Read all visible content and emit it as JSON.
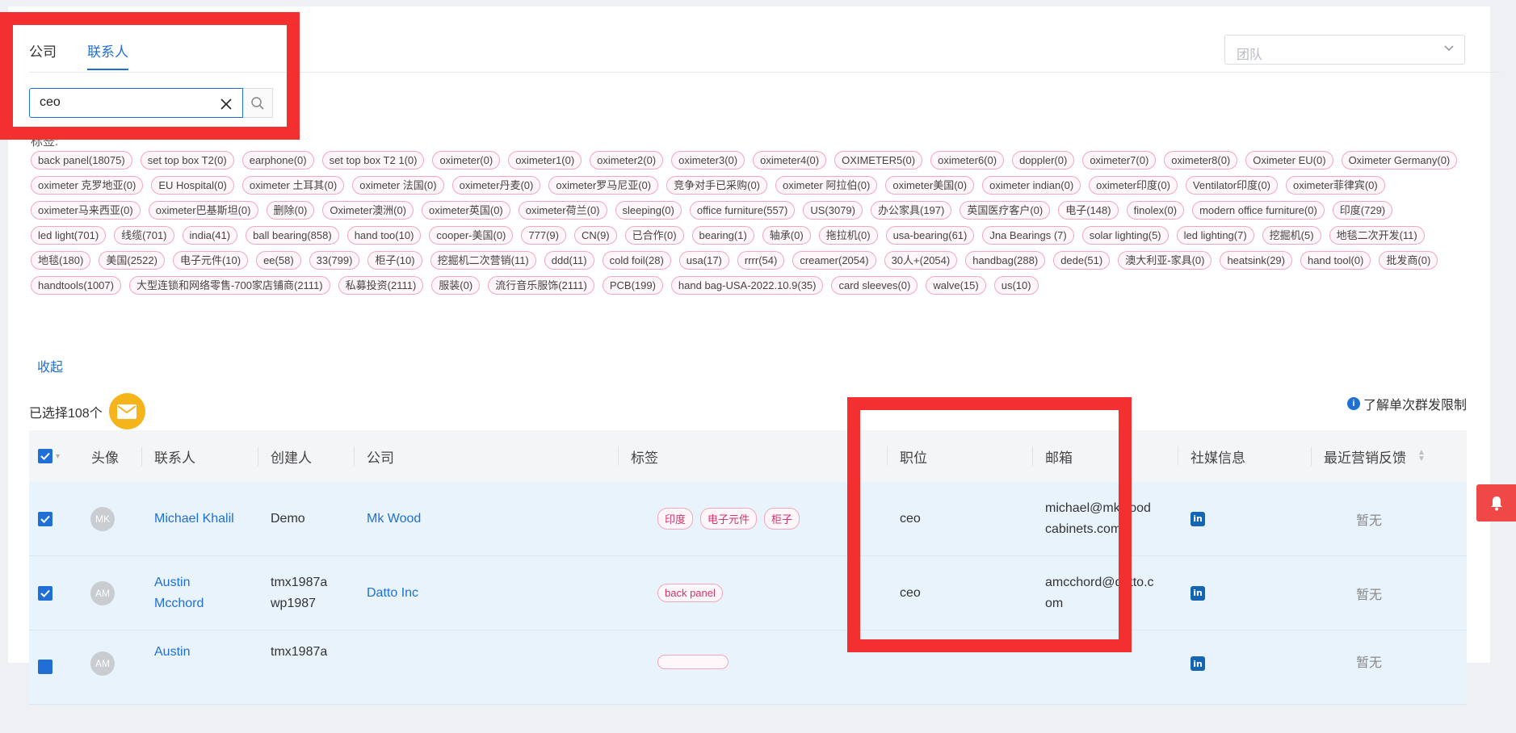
{
  "tabs": [
    {
      "label": "公司"
    },
    {
      "label": "联系人"
    }
  ],
  "team_select": {
    "placeholder": "团队"
  },
  "search": {
    "value": "ceo"
  },
  "tags_label": "标签:",
  "tags": [
    "back panel(18075)",
    "set top box T2(0)",
    "earphone(0)",
    "set top box T2 1(0)",
    "oximeter(0)",
    "oximeter1(0)",
    "oximeter2(0)",
    "oximeter3(0)",
    "oximeter4(0)",
    "OXIMETER5(0)",
    "oximeter6(0)",
    "doppler(0)",
    "oximeter7(0)",
    "oximeter8(0)",
    "Oximeter EU(0)",
    "Oximeter Germany(0)",
    "oximeter 克罗地亚(0)",
    "EU Hospital(0)",
    "oximeter 土耳其(0)",
    "oximeter 法国(0)",
    "oximeter丹麦(0)",
    "oximeter罗马尼亚(0)",
    "竞争对手已采购(0)",
    "oximeter 阿拉伯(0)",
    "oximeter美国(0)",
    "oximeter indian(0)",
    "oximeter印度(0)",
    "Ventilator印度(0)",
    "oximeter菲律宾(0)",
    "oximeter马来西亚(0)",
    "oximeter巴基斯坦(0)",
    "删除(0)",
    "Oximeter澳洲(0)",
    "oximeter英国(0)",
    "oximeter荷兰(0)",
    "sleeping(0)",
    "office furniture(557)",
    "US(3079)",
    "办公家具(197)",
    "英国医疗客户(0)",
    "电子(148)",
    "finolex(0)",
    "modern office furniture(0)",
    "印度(729)",
    "led light(701)",
    "线缆(701)",
    "india(41)",
    "ball bearing(858)",
    "hand too(10)",
    "cooper-美国(0)",
    "777(9)",
    "CN(9)",
    "已合作(0)",
    "bearing(1)",
    "轴承(0)",
    "拖拉机(0)",
    "usa-bearing(61)",
    "Jna Bearings (7)",
    "solar lighting(5)",
    "led lighting(7)",
    "挖掘机(5)",
    "地毯二次开发(11)",
    "地毯(180)",
    "美国(2522)",
    "电子元件(10)",
    "ee(58)",
    "33(799)",
    "柜子(10)",
    "挖掘机二次营销(11)",
    "ddd(11)",
    "cold foil(28)",
    "usa(17)",
    "rrrr(54)",
    "creamer(2054)",
    "30人+(2054)",
    "handbag(288)",
    "dede(51)",
    "澳大利亚-家具(0)",
    "heatsink(29)",
    "hand tool(0)",
    "批发商(0)",
    "handtools(1007)",
    "大型连锁和网络零售-700家店铺商(2111)",
    "私募投资(2111)",
    "服装(0)",
    "流行音乐服饰(2111)",
    "PCB(199)",
    "hand bag-USA-2022.10.9(35)",
    "card sleeves(0)",
    "walve(15)",
    "us(10)"
  ],
  "collapse_label": "收起",
  "selected_text": "已选择108个",
  "limit_text": "了解单次群发限制",
  "table": {
    "headers": {
      "avatar": "头像",
      "contact": "联系人",
      "creator": "创建人",
      "company": "公司",
      "tags": "标签",
      "position": "职位",
      "email": "邮箱",
      "social": "社媒信息",
      "feedback": "最近营销反馈"
    },
    "rows": [
      {
        "initials": "MK",
        "contact": "Michael Khalil",
        "creator": "Demo",
        "company": "Mk Wood",
        "tags": [
          "印度",
          "电子元件",
          "柜子"
        ],
        "position": "ceo",
        "email_line1": "michael@mkwood",
        "email_line2": "cabinets.com",
        "feedback": "暂无"
      },
      {
        "initials": "AM",
        "contact_line1": "Austin",
        "contact_line2": "Mcchord",
        "creator_line1": "tmx1987a",
        "creator_line2": "wp1987",
        "company": "Datto Inc",
        "tags": [
          "back panel"
        ],
        "position": "ceo",
        "email_line1": "amcchord@datto.c",
        "email_line2": "om",
        "feedback": "暂无"
      },
      {
        "initials": "AM",
        "contact_line1": "Austin",
        "creator_line1": "tmx1987a",
        "feedback": "暂无"
      }
    ]
  },
  "colors": {
    "accent": "#1f6fd6",
    "annotation": "#f32f2f",
    "tag_border": "#f2a7bd",
    "selected_row": "#e9f3fc"
  }
}
